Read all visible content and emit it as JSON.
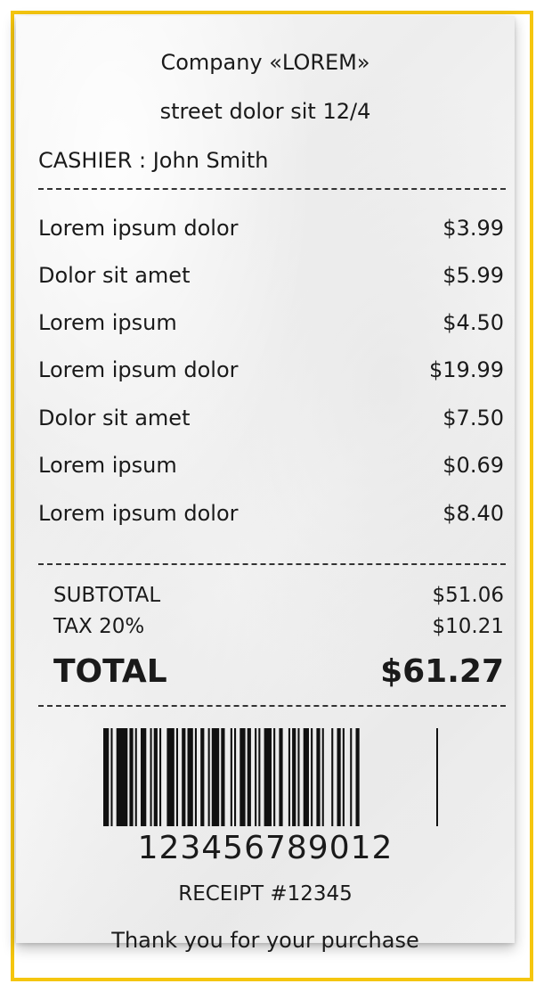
{
  "header": {
    "company": "Company «LOREM»",
    "address": "street dolor sit 12/4",
    "cashier": "CASHIER : John Smith"
  },
  "items": [
    {
      "name": "Lorem ipsum dolor",
      "price": "$3.99"
    },
    {
      "name": "Dolor sit amet",
      "price": "$5.99"
    },
    {
      "name": "Lorem ipsum",
      "price": "$4.50"
    },
    {
      "name": "Lorem ipsum dolor",
      "price": "$19.99"
    },
    {
      "name": "Dolor sit amet",
      "price": "$7.50"
    },
    {
      "name": "Lorem ipsum",
      "price": "$0.69"
    },
    {
      "name": "Lorem ipsum dolor",
      "price": "$8.40"
    }
  ],
  "summary": {
    "subtotal_label": "SUBTOTAL",
    "subtotal_value": "$51.06",
    "tax_label": "TAX 20%",
    "tax_value": "$10.21",
    "total_label": "TOTAL",
    "total_value": "$61.27"
  },
  "barcode": {
    "number": "123456789012"
  },
  "footer": {
    "receipt_number": "RECEIPT #12345",
    "thank_you": "Thank you for your purchase"
  },
  "colors": {
    "frame": "#f5c60f",
    "ink": "#1a1a1a",
    "paper": "#f2f2f2"
  }
}
